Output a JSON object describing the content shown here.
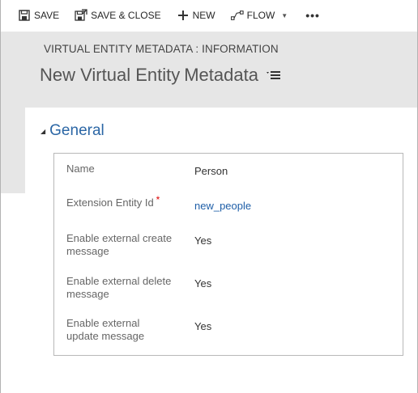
{
  "toolbar": {
    "save_label": "SAVE",
    "save_close_label": "SAVE & CLOSE",
    "new_label": "NEW",
    "flow_label": "FLOW",
    "more_label": "•••"
  },
  "header": {
    "entity_type": "VIRTUAL ENTITY METADATA : INFORMATION",
    "title_part1": "New Virtual Entity",
    "title_part2": "Metadata"
  },
  "section": {
    "title": "General",
    "fields": [
      {
        "label": "Name",
        "value": "Person"
      },
      {
        "label": "Extension Entity Id",
        "required_marker": "*",
        "value": "new_people"
      },
      {
        "label_line1": "Enable external create",
        "label_line2": "message",
        "value": "Yes"
      },
      {
        "label_line1": "Enable external delete",
        "label_line2": "message",
        "value": "Yes"
      },
      {
        "label_line1": "Enable external",
        "label_line2": "update message",
        "value": "Yes"
      }
    ]
  },
  "colors": {
    "accent": "#2b66a5",
    "header_band": "#e6e6e6",
    "required": "#dd0000"
  },
  "icons": [
    "save-icon",
    "save-close-icon",
    "plus-icon",
    "flow-icon",
    "chevron-down-icon",
    "more-icon",
    "collapse-triangle-icon",
    "menu-lines-icon"
  ]
}
